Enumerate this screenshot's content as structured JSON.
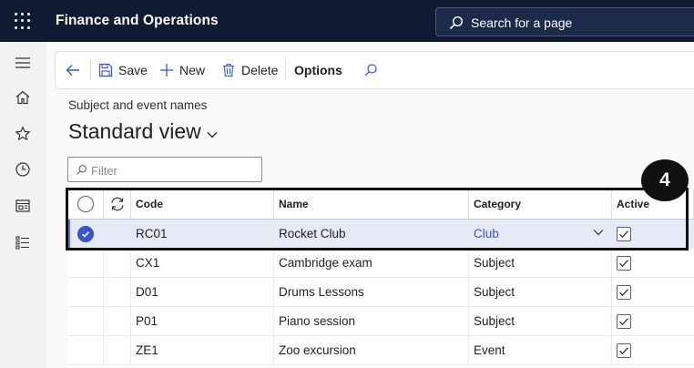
{
  "app": {
    "title": "Finance and Operations"
  },
  "search": {
    "placeholder": "Search for a page"
  },
  "rail": {
    "icons": [
      "hamburger-icon",
      "home-icon",
      "star-icon",
      "clock-icon",
      "workspace-icon",
      "list-icon"
    ]
  },
  "actionbar": {
    "save_label": "Save",
    "new_label": "New",
    "delete_label": "Delete",
    "options_label": "Options"
  },
  "page": {
    "breadcrumb": "Subject and event names",
    "view_title": "Standard view"
  },
  "filter": {
    "placeholder": "Filter"
  },
  "grid": {
    "columns": {
      "code": "Code",
      "name": "Name",
      "category": "Category",
      "active": "Active"
    },
    "rows": [
      {
        "code": "RC01",
        "name": "Rocket Club",
        "category": "Club",
        "active": true,
        "selected": true
      },
      {
        "code": "CX1",
        "name": "Cambridge exam",
        "category": "Subject",
        "active": true,
        "selected": false
      },
      {
        "code": "D01",
        "name": "Drums Lessons",
        "category": "Subject",
        "active": true,
        "selected": false
      },
      {
        "code": "P01",
        "name": "Piano session",
        "category": "Subject",
        "active": true,
        "selected": false
      },
      {
        "code": "ZE1",
        "name": "Zoo excursion",
        "category": "Event",
        "active": true,
        "selected": false
      }
    ]
  },
  "callout": {
    "number": "4"
  },
  "colors": {
    "topbar": "#0e1b33",
    "accent": "#3a55c8",
    "selected_row": "#e6e9f6"
  }
}
